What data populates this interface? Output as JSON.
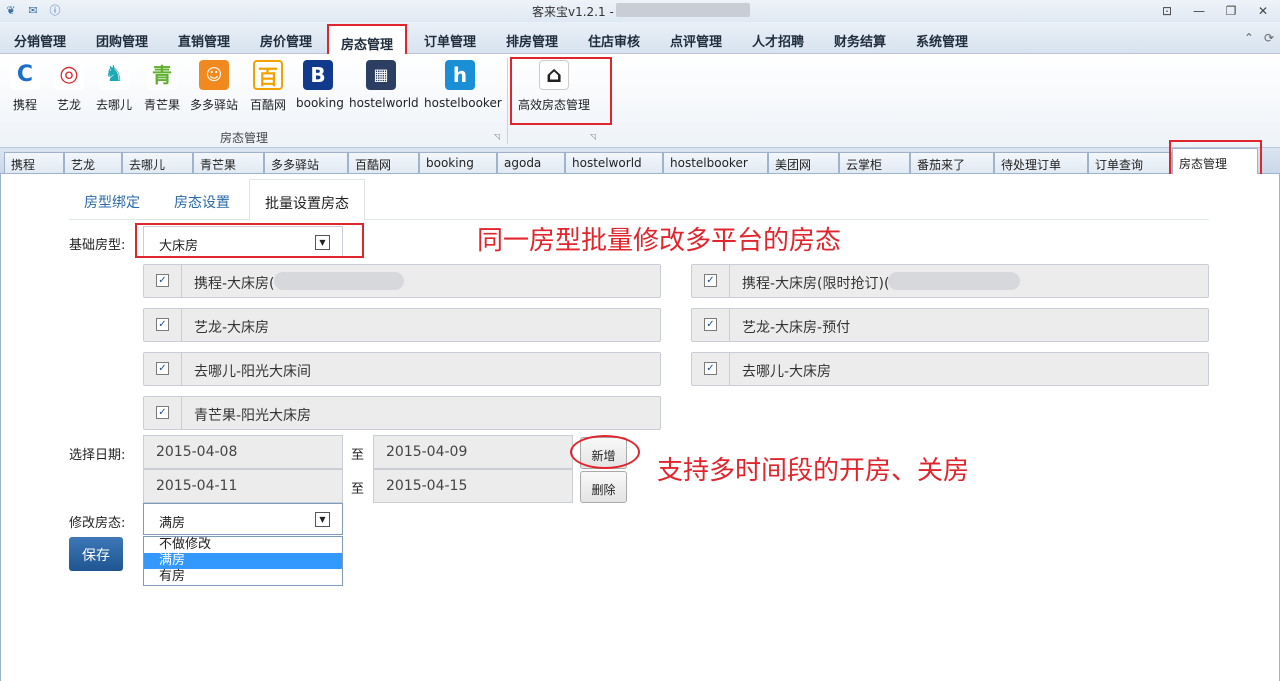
{
  "window": {
    "title": "客来宝v1.2.1 -",
    "buttons": [
      "⊡",
      "—",
      "❐",
      "✕"
    ]
  },
  "menu": {
    "items": [
      "分销管理",
      "团购管理",
      "直销管理",
      "房价管理",
      "房态管理",
      "订单管理",
      "排房管理",
      "住店审核",
      "点评管理",
      "人才招聘",
      "财务结算",
      "系统管理"
    ],
    "active": "房态管理",
    "right_icons": [
      "⌃",
      "⟳"
    ]
  },
  "ribbon": {
    "items": [
      {
        "label": "携程",
        "icon": "ctrip-icon",
        "glyph": "C",
        "color": "#1c6fc9"
      },
      {
        "label": "艺龙",
        "icon": "elong-icon",
        "glyph": "◎",
        "color": "#d8262c"
      },
      {
        "label": "去哪儿",
        "icon": "qunar-icon",
        "glyph": "♞",
        "color": "#1aa9b5"
      },
      {
        "label": "青芒果",
        "icon": "qingmangguo-icon",
        "glyph": "青",
        "color": "#5fb02f"
      },
      {
        "label": "多多驿站",
        "icon": "duoduo-icon",
        "glyph": "☺",
        "color": "#f08a1e"
      },
      {
        "label": "百酷网",
        "icon": "baiku-icon",
        "glyph": "百",
        "color": "#f2a100"
      },
      {
        "label": "booking",
        "icon": "booking-icon",
        "glyph": "B",
        "color": "#123a8c"
      },
      {
        "label": "hostelworld",
        "icon": "hostelworld-icon",
        "glyph": "▦",
        "color": "#2d3e63"
      },
      {
        "label": "hostelbooker",
        "icon": "hostelbooker-icon",
        "glyph": "h",
        "color": "#1a8fd6"
      }
    ],
    "group_label": "房态管理",
    "extra_item": {
      "label": "高效房态管理",
      "icon": "house-icon",
      "glyph": "⌂"
    }
  },
  "doctabs": {
    "items": [
      "携程",
      "艺龙",
      "去哪儿",
      "青芒果",
      "多多驿站",
      "百酷网",
      "booking",
      "agoda",
      "hostelworld",
      "hostelbooker",
      "美团网",
      "云掌柜",
      "番茄来了",
      "待处理订单",
      "订单查询"
    ],
    "active": "房态管理",
    "close": "✕"
  },
  "subtabs": {
    "items": [
      "房型绑定",
      "房态设置",
      "批量设置房态"
    ],
    "active": "批量设置房态"
  },
  "form": {
    "room_type_label": "基础房型:",
    "room_type_value": "大床房",
    "checkboxes": [
      {
        "label": "携程-大床房(",
        "checked": true
      },
      {
        "label": "携程-大床房(限时抢订)(",
        "checked": true
      },
      {
        "label": "艺龙-大床房",
        "checked": true
      },
      {
        "label": "艺龙-大床房-预付",
        "checked": true
      },
      {
        "label": "去哪儿-阳光大床间",
        "checked": true
      },
      {
        "label": "去哪儿-大床房",
        "checked": true
      },
      {
        "label": "青芒果-阳光大床房",
        "checked": true
      }
    ],
    "date_label": "选择日期:",
    "to_label": "至",
    "date_ranges": [
      {
        "from": "2015-04-08",
        "to": "2015-04-09"
      },
      {
        "from": "2015-04-11",
        "to": "2015-04-15"
      }
    ],
    "add_button": "新增",
    "delete_button": "删除",
    "status_label": "修改房态:",
    "status_value": "满房",
    "status_options": [
      "不做修改",
      "满房",
      "有房"
    ],
    "save_button": "保存"
  },
  "annotations": {
    "top": "同一房型批量修改多平台的房态",
    "dates": "支持多时间段的开房、关房"
  },
  "colors": {
    "highlight": "#e0262d",
    "selected_option": "#3399ff",
    "save_button": "#2a64a3"
  }
}
